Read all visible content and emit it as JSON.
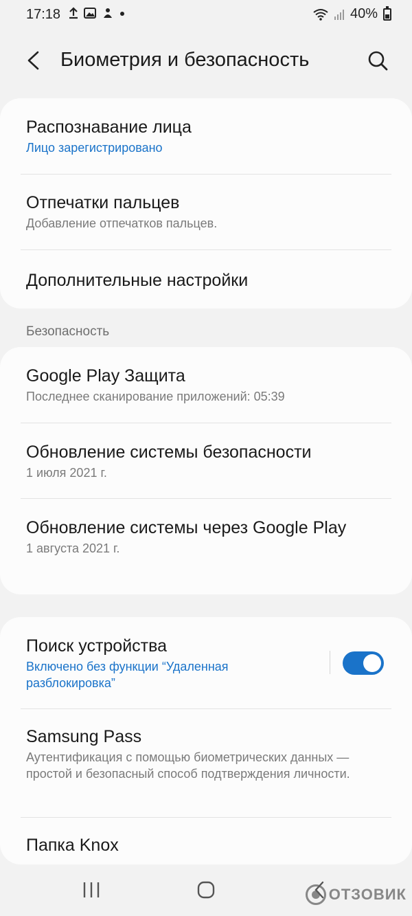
{
  "status_bar": {
    "time": "17:18",
    "battery": "40%"
  },
  "header": {
    "title": "Биометрия и безопасность"
  },
  "biometrics": [
    {
      "title": "Распознавание лица",
      "subtitle": "Лицо зарегистрировано"
    },
    {
      "title": "Отпечатки пальцев",
      "subtitle": "Добавление отпечатков пальцев."
    },
    {
      "title": "Дополнительные настройки"
    }
  ],
  "security_section_label": "Безопасность",
  "security": [
    {
      "title": "Google Play Защита",
      "subtitle": "Последнее сканирование приложений: 05:39"
    },
    {
      "title": "Обновление системы безопасности",
      "subtitle": "1 июля 2021 г."
    },
    {
      "title": "Обновление системы через Google Play",
      "subtitle": "1 августа 2021 г."
    }
  ],
  "device": [
    {
      "title": "Поиск устройства",
      "subtitle": "Включено без функции “Удаленная разблокировка”",
      "toggle": true
    },
    {
      "title": "Samsung Pass",
      "subtitle": "Аутентификация с помощью биометрических данных — простой и безопасный способ подтверждения личности."
    },
    {
      "title": "Папка Knox"
    }
  ],
  "watermark": "ОТЗОВИК",
  "colors": {
    "accent": "#1a73c9",
    "background": "#f2f2f2",
    "card": "#fcfcfc"
  }
}
